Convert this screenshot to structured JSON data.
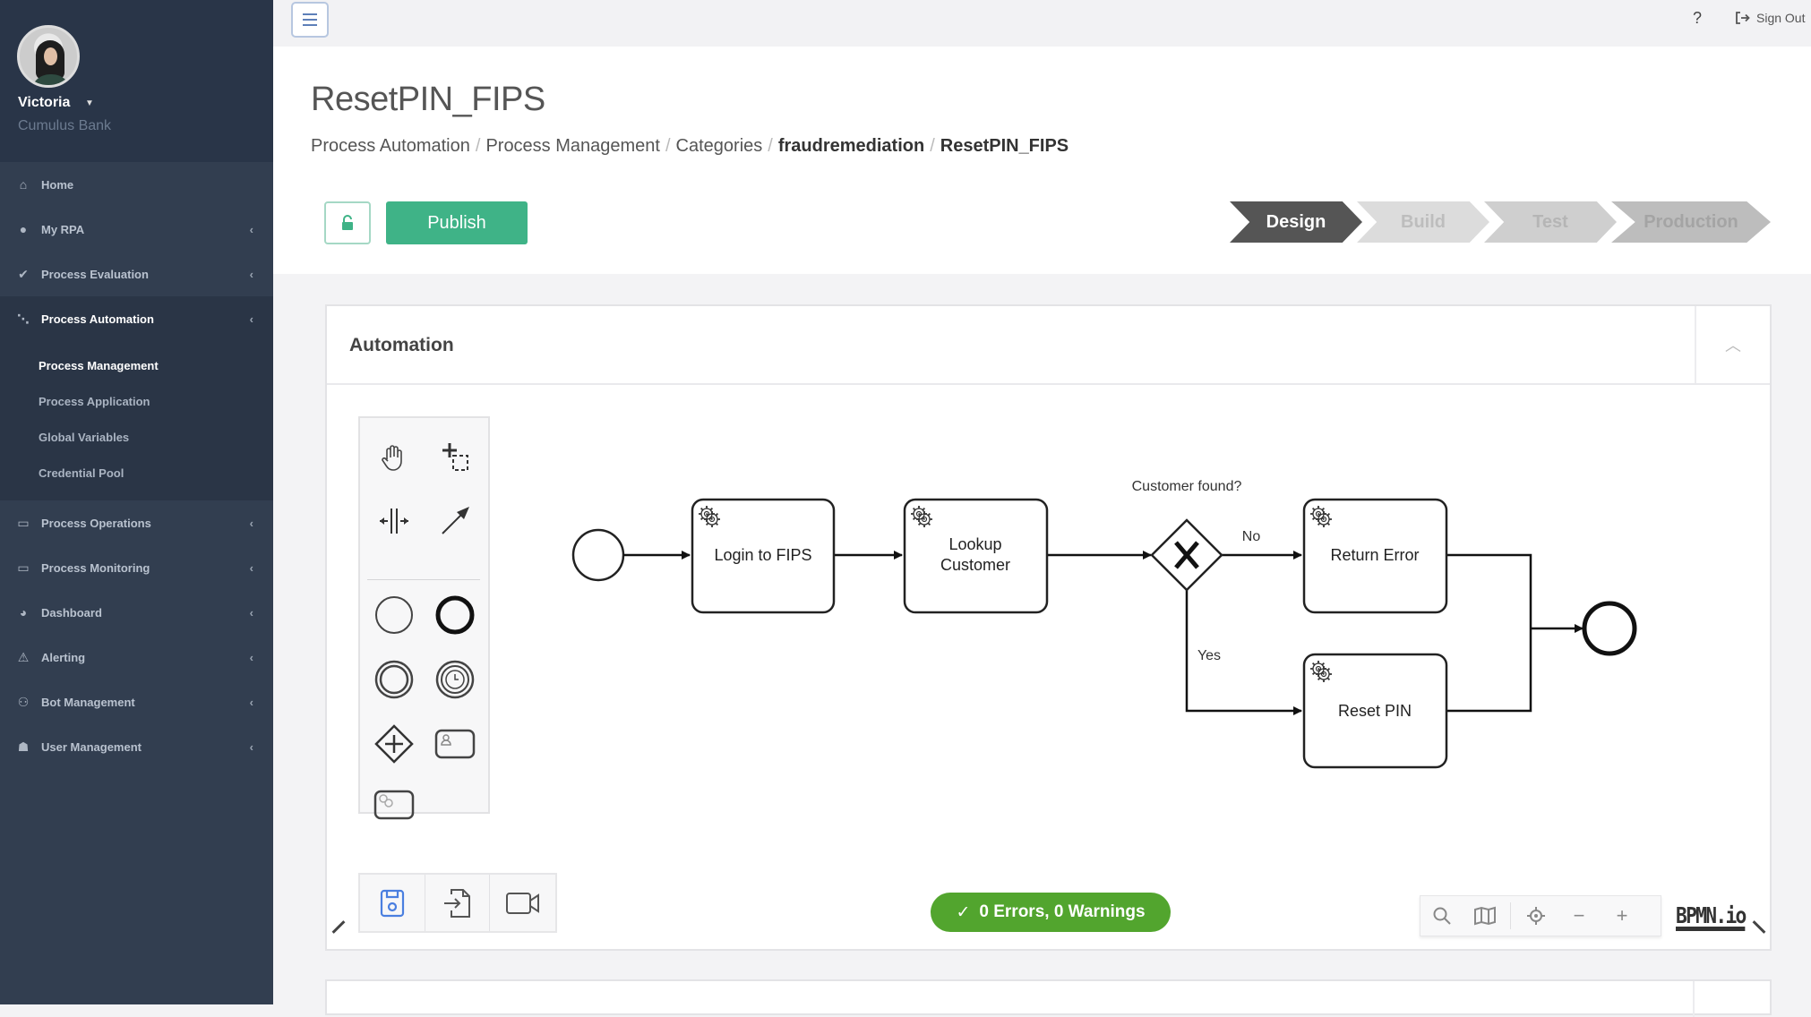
{
  "user": {
    "name": "Victoria",
    "organization": "Cumulus Bank"
  },
  "sidebar": {
    "items": [
      {
        "label": "Home",
        "icon": "home-icon",
        "has_chevron": false
      },
      {
        "label": "My RPA",
        "icon": "user-icon",
        "has_chevron": true
      },
      {
        "label": "Process Evaluation",
        "icon": "check-icon",
        "has_chevron": true
      },
      {
        "label": "Process Automation",
        "icon": "flow-icon",
        "has_chevron": true,
        "active": true,
        "children": [
          {
            "label": "Process Management",
            "active": true
          },
          {
            "label": "Process Application"
          },
          {
            "label": "Global Variables"
          },
          {
            "label": "Credential Pool"
          }
        ]
      },
      {
        "label": "Process Operations",
        "icon": "operations-icon",
        "has_chevron": true
      },
      {
        "label": "Process Monitoring",
        "icon": "monitor-icon",
        "has_chevron": true
      },
      {
        "label": "Dashboard",
        "icon": "pie-chart-icon",
        "has_chevron": true
      },
      {
        "label": "Alerting",
        "icon": "warning-icon",
        "has_chevron": true
      },
      {
        "label": "Bot Management",
        "icon": "bot-icon",
        "has_chevron": true
      },
      {
        "label": "User Management",
        "icon": "users-icon",
        "has_chevron": true
      }
    ]
  },
  "topbar": {
    "help_label": "?",
    "signout_label": "Sign Out"
  },
  "page": {
    "title": "ResetPIN_FIPS",
    "breadcrumb": [
      "Process Automation",
      "Process Management",
      "Categories",
      "fraudremediation",
      "ResetPIN_FIPS"
    ],
    "publish_label": "Publish",
    "stages": [
      "Design",
      "Build",
      "Test",
      "Production"
    ],
    "active_stage": "Design"
  },
  "panel": {
    "title": "Automation",
    "status": "0 Errors, 0 Warnings",
    "logo": "BPMN.io",
    "palette_tools": [
      "hand-tool",
      "lasso-tool",
      "space-tool",
      "connect-tool",
      "start-event",
      "end-event",
      "intermediate-event",
      "timer-event",
      "exclusive-gateway",
      "user-task",
      "service-task"
    ],
    "bottom_tools": [
      "save",
      "import",
      "record"
    ],
    "zoom_controls": [
      "search",
      "minimap",
      "center",
      "zoom-out",
      "zoom-in"
    ]
  },
  "diagram": {
    "tasks": [
      {
        "id": "login",
        "label": [
          "Login to FIPS"
        ]
      },
      {
        "id": "lookup",
        "label": [
          "Lookup",
          "Customer"
        ]
      },
      {
        "id": "error",
        "label": [
          "Return Error"
        ]
      },
      {
        "id": "reset",
        "label": [
          "Reset PIN"
        ]
      }
    ],
    "gateway_label": "Customer found?",
    "flow_labels": {
      "no": "No",
      "yes": "Yes"
    }
  }
}
